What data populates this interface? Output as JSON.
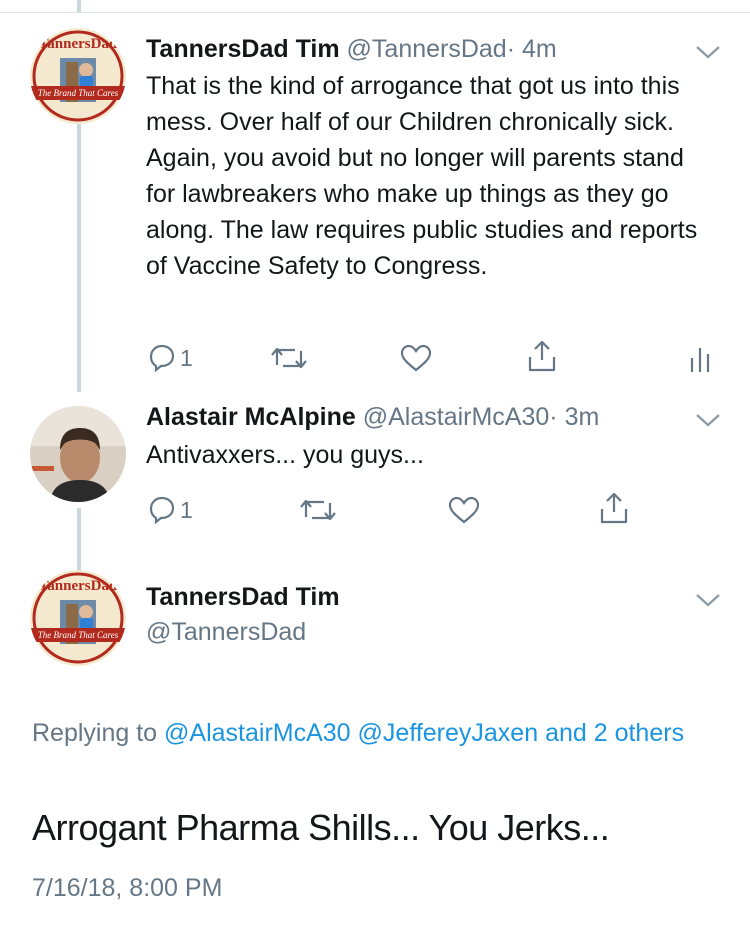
{
  "tweets": [
    {
      "name": "TannersDad Tim",
      "handle": "@TannersDad",
      "time": "· 4m",
      "text": "That is the kind of arrogance that got us into this mess. Over half of our Children chronically sick. Again, you avoid but no longer will parents stand for lawbreakers who make up things as they go along. The law requires public studies and reports of Vaccine Safety to Congress.",
      "replies": "1",
      "avatar_text": "TannersDad",
      "avatar_banner": "The Brand That Cares"
    },
    {
      "name": "Alastair McAlpine",
      "handle": "@AlastairMcA30",
      "time": "· 3m",
      "text": "Antivaxxers... you guys...",
      "replies": "1"
    }
  ],
  "focus_tweet": {
    "name": "TannersDad Tim",
    "handle": "@TannersDad",
    "replying_prefix": "Replying to ",
    "replying_user1": "@AlastairMcA30",
    "replying_user2": "@JeffereyJaxen",
    "replying_and": "and 2 others",
    "text": "Arrogant Pharma Shills... You Jerks...",
    "timestamp": "7/16/18, 8:00 PM"
  },
  "icons": [
    "reply-icon",
    "retweet-icon",
    "like-icon",
    "share-icon",
    "analytics-icon",
    "chevron-down-icon"
  ],
  "colors": {
    "link": "#1b95e0",
    "secondary": "#657786",
    "thread": "#ccd6dd"
  }
}
